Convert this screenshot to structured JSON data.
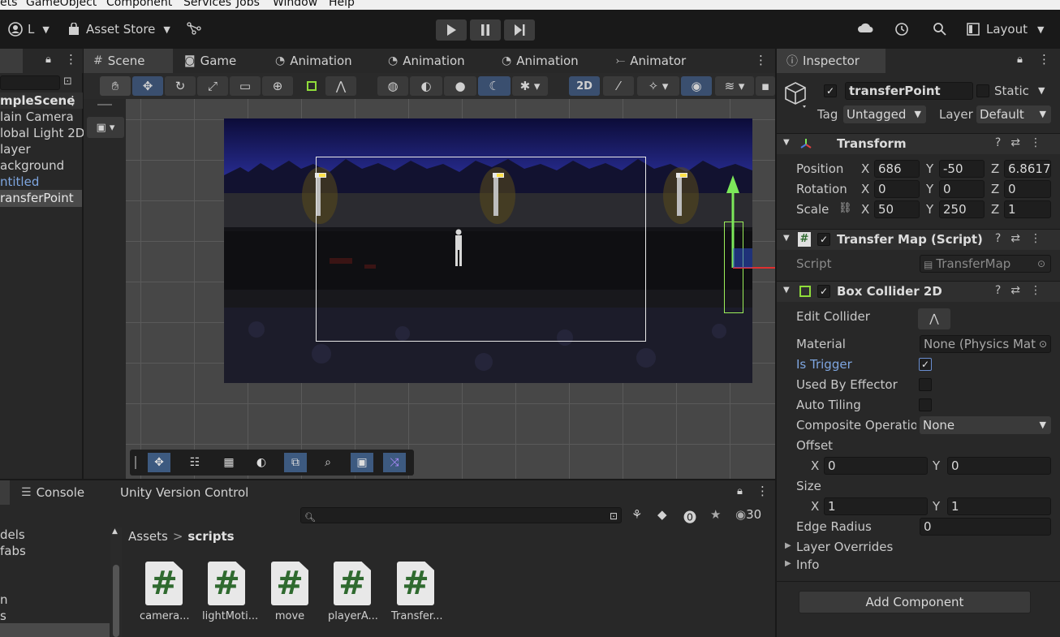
{
  "menu": [
    "ets",
    "GameObject",
    "Component",
    "Services",
    "Jobs",
    "Window",
    "Help"
  ],
  "toolbar": {
    "account": "L",
    "asset_store": "Asset Store",
    "layout": "Layout"
  },
  "hierarchy": {
    "scene": "mpleScene",
    "items": [
      "lain Camera",
      "lobal Light 2D",
      "layer",
      "ackground",
      "ntitled",
      "ransferPoint"
    ]
  },
  "scene_tabs": [
    "Scene",
    "Game",
    "Animation",
    "Animation",
    "Animation",
    "Animator"
  ],
  "scene_toolbar": {
    "mode_2d": "2D"
  },
  "inspector": {
    "tab": "Inspector",
    "object_name": "transferPoint",
    "static_label": "Static",
    "tag_label": "Tag",
    "tag_value": "Untagged",
    "layer_label": "Layer",
    "layer_value": "Default",
    "transform": {
      "title": "Transform",
      "position_label": "Position",
      "rotation_label": "Rotation",
      "scale_label": "Scale",
      "x": "X",
      "y": "Y",
      "z": "Z",
      "position": [
        "686",
        "-50",
        "6.8617"
      ],
      "rotation": [
        "0",
        "0",
        "0"
      ],
      "scale": [
        "50",
        "250",
        "1"
      ]
    },
    "transfer_map": {
      "title": "Transfer Map (Script)",
      "script_label": "Script",
      "script_value": "TransferMap"
    },
    "box_collider": {
      "title": "Box Collider 2D",
      "edit_collider": "Edit Collider",
      "material_label": "Material",
      "material_value": "None (Physics Mat",
      "is_trigger": "Is Trigger",
      "used_by_effector": "Used By Effector",
      "auto_tiling": "Auto Tiling",
      "composite_label": "Composite Operatior",
      "composite_value": "None",
      "offset_label": "Offset",
      "offset": [
        "0",
        "0"
      ],
      "size_label": "Size",
      "size": [
        "1",
        "1"
      ],
      "edge_radius_label": "Edge Radius",
      "edge_radius": "0",
      "layer_overrides": "Layer Overrides",
      "info": "Info"
    },
    "add_component": "Add Component"
  },
  "bottom": {
    "tabs": [
      "Console",
      "Unity Version Control"
    ],
    "count": "30",
    "breadcrumb_root": "Assets",
    "breadcrumb_sep": ">",
    "breadcrumb_current": "scripts",
    "folders": [
      "dels",
      "fabs",
      "n",
      "s"
    ],
    "assets": [
      "camera...",
      "lightMoti...",
      "move",
      "playerA...",
      "Transfer..."
    ],
    "asset_glyph": "#"
  }
}
